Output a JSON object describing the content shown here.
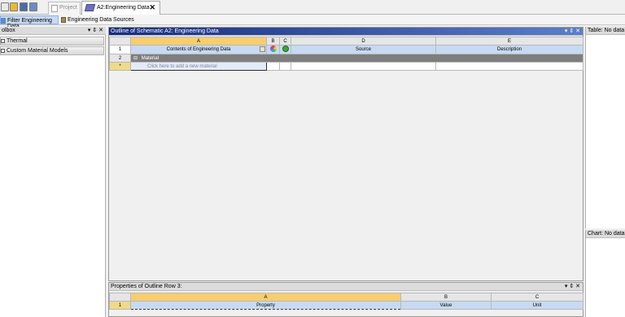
{
  "top_tabs": {
    "project": "Project",
    "engineering_data": "A2:Engineering Data",
    "close": "✕"
  },
  "toolbar": {
    "filter_label": "Filter Engineering Data",
    "sources_label": "Engineering Data Sources"
  },
  "toolbox": {
    "title": "olbox",
    "controls": "▾ ⇕ ✕",
    "items": [
      {
        "label": "Thermal"
      },
      {
        "label": "Custom Material Models"
      }
    ]
  },
  "outline": {
    "title": "Outline of Schematic A2: Engineering Data",
    "controls": "▾ ⇕ ✕",
    "columns": [
      "A",
      "B",
      "C",
      "D",
      "E"
    ],
    "headers": {
      "row": "1",
      "contents": "Contents of Engineering Data",
      "source": "Source",
      "description": "Description"
    },
    "section_row": {
      "row": "2",
      "label": "Material",
      "expand": "⊟"
    },
    "add_row": {
      "row": "*",
      "placeholder": "Click here to add a new material"
    }
  },
  "properties": {
    "title": "Properties of Outline Row 3:",
    "controls": "▾ ⇕ ✕",
    "columns": [
      "A",
      "B",
      "C"
    ],
    "row": "1",
    "headers": [
      "Property",
      "Value",
      "Unit"
    ]
  },
  "right_panels": {
    "table_title": "Table: No data",
    "chart_title": "Chart: No data"
  },
  "colors": {
    "active_header_start": "#162c7e",
    "active_header_end": "#5b7fc8",
    "selected_column": "#f8cd6d",
    "label_row": "#c7daf2",
    "section_row": "#7e7e7e"
  }
}
